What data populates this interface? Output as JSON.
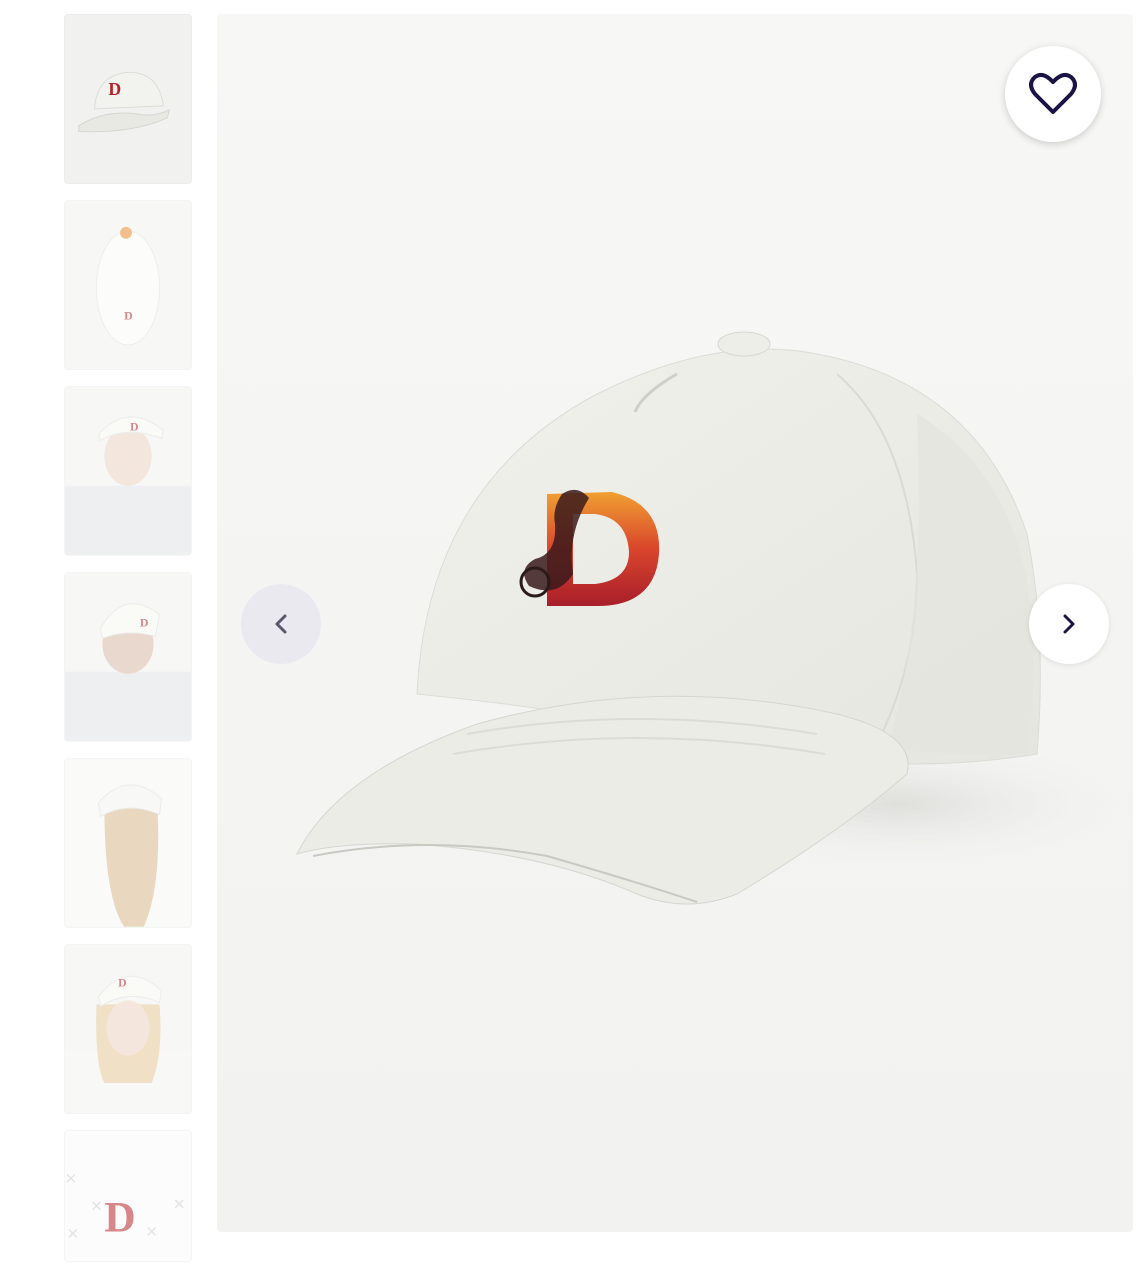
{
  "gallery": {
    "thumbnails": [
      {
        "name": "cap-front",
        "active": true
      },
      {
        "name": "cap-top"
      },
      {
        "name": "model-man-front"
      },
      {
        "name": "model-man-back"
      },
      {
        "name": "model-woman-back"
      },
      {
        "name": "model-woman-front"
      },
      {
        "name": "design-pattern"
      }
    ],
    "favorite_icon": "heart-outline-icon",
    "prev_icon": "chevron-left-icon",
    "next_icon": "chevron-right-icon"
  },
  "colors": {
    "accent": "#1a1446",
    "nav_prev_bg": "#eae8f0",
    "cap": "#efefea",
    "logo_orange": "#e8892e",
    "logo_red": "#b8242a"
  }
}
